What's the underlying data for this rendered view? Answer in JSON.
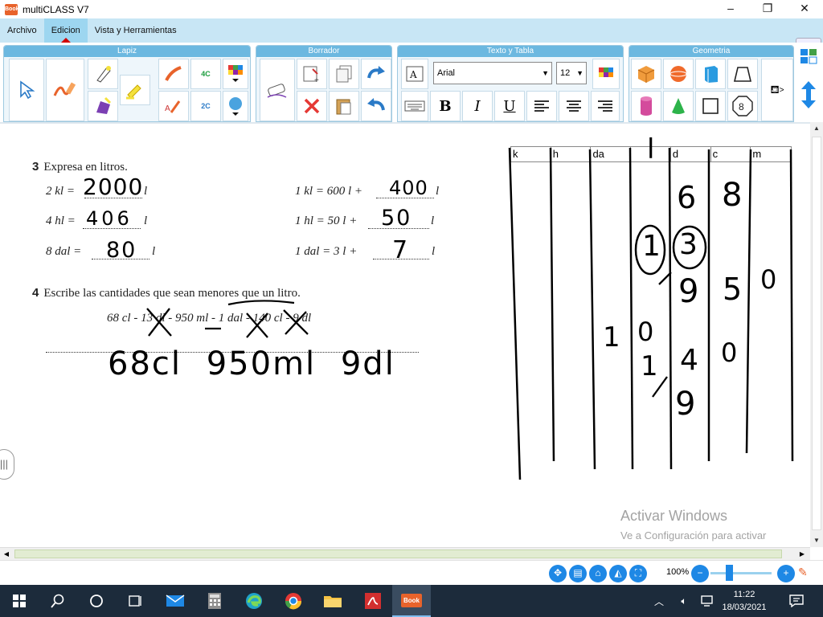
{
  "window": {
    "title": "multiCLASS V7",
    "app_icon_text": "Book",
    "minimize": "–",
    "maximize": "❐",
    "close": "✕"
  },
  "menu": {
    "items": [
      "Archivo",
      "Edicion",
      "Vista y Herramientas"
    ],
    "active": "Edicion",
    "collapse_icon": "chevron-up-icon"
  },
  "ribbon": {
    "groups": [
      {
        "name": "Lapiz"
      },
      {
        "name": "Borrador"
      },
      {
        "name": "Texto y Tabla"
      },
      {
        "name": "Geometria"
      }
    ],
    "font_name": "Arial",
    "font_size": "12",
    "more_label": ">",
    "shape_label": "8",
    "tool_labels": {
      "marker_4c": "4C",
      "marker_2c": "2C"
    },
    "text_buttons": {
      "bold": "B",
      "italic": "I",
      "underline": "U"
    }
  },
  "worksheet": {
    "ex3": {
      "number": "3",
      "prompt": "Expresa en litros.",
      "left_items": [
        {
          "lhs": "2 kl =",
          "unit": "l",
          "answer": "2000"
        },
        {
          "lhs": "4 hl =",
          "unit": "l",
          "answer": "406"
        },
        {
          "lhs": "8 dal =",
          "unit": "l",
          "answer": "80"
        }
      ],
      "right_items": [
        {
          "lhs": "1 kl = 600 l +",
          "unit": "l",
          "answer": "400"
        },
        {
          "lhs": "1 hl = 50 l +",
          "unit": "l",
          "answer": "50"
        },
        {
          "lhs": "1 dal = 3 l +",
          "unit": "l",
          "answer": "7"
        }
      ]
    },
    "ex4": {
      "number": "4",
      "prompt": "Escribe las cantidades que sean menores que un litro.",
      "list": "68 cl - 13 dl - 950 ml - 1 dal - 140 cl - 9 dl",
      "handwritten_answer": "68cl  950ml  9dl"
    },
    "unit_table": {
      "headers": [
        "k",
        "h",
        "da",
        "l",
        "d",
        "c",
        "m"
      ],
      "handwritten_marks": [
        "6",
        "8",
        "1",
        "3",
        "9",
        "5",
        "0",
        "1",
        "0",
        "1",
        "4",
        "0",
        "9"
      ]
    }
  },
  "watermark": {
    "line1": "Activar Windows",
    "line2": "Ve a Configuración para activar Windows."
  },
  "statusbar": {
    "zoom": "100%",
    "zoom_level": 0.3
  },
  "taskbar": {
    "time": "11:22",
    "date": "18/03/2021",
    "active_app": "multiCLASS"
  }
}
